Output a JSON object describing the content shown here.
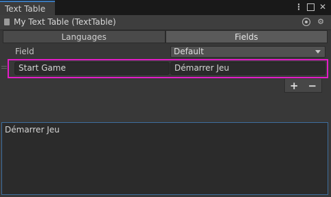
{
  "window": {
    "tab_title": "Text Table"
  },
  "tab_icons": [
    {
      "name": "more-options-icon",
      "glyph": "⋮"
    },
    {
      "name": "maximize-icon",
      "glyph": ""
    },
    {
      "name": "close-icon",
      "glyph": "✕"
    }
  ],
  "object": {
    "name": "My Text Table (TextTable)"
  },
  "segments": [
    {
      "label": "Languages",
      "active": false
    },
    {
      "label": "Fields",
      "active": true
    }
  ],
  "columns": {
    "field_label": "Field",
    "language_dropdown": "Default"
  },
  "row": {
    "field": "Start Game",
    "value": "Démarrer Jeu"
  },
  "footer": {
    "add": "+",
    "remove": "−"
  },
  "preview": {
    "text": "Démarrer Jeu"
  },
  "colors": {
    "selection_outline": "#e31cc7",
    "accent": "#3a79bb"
  }
}
